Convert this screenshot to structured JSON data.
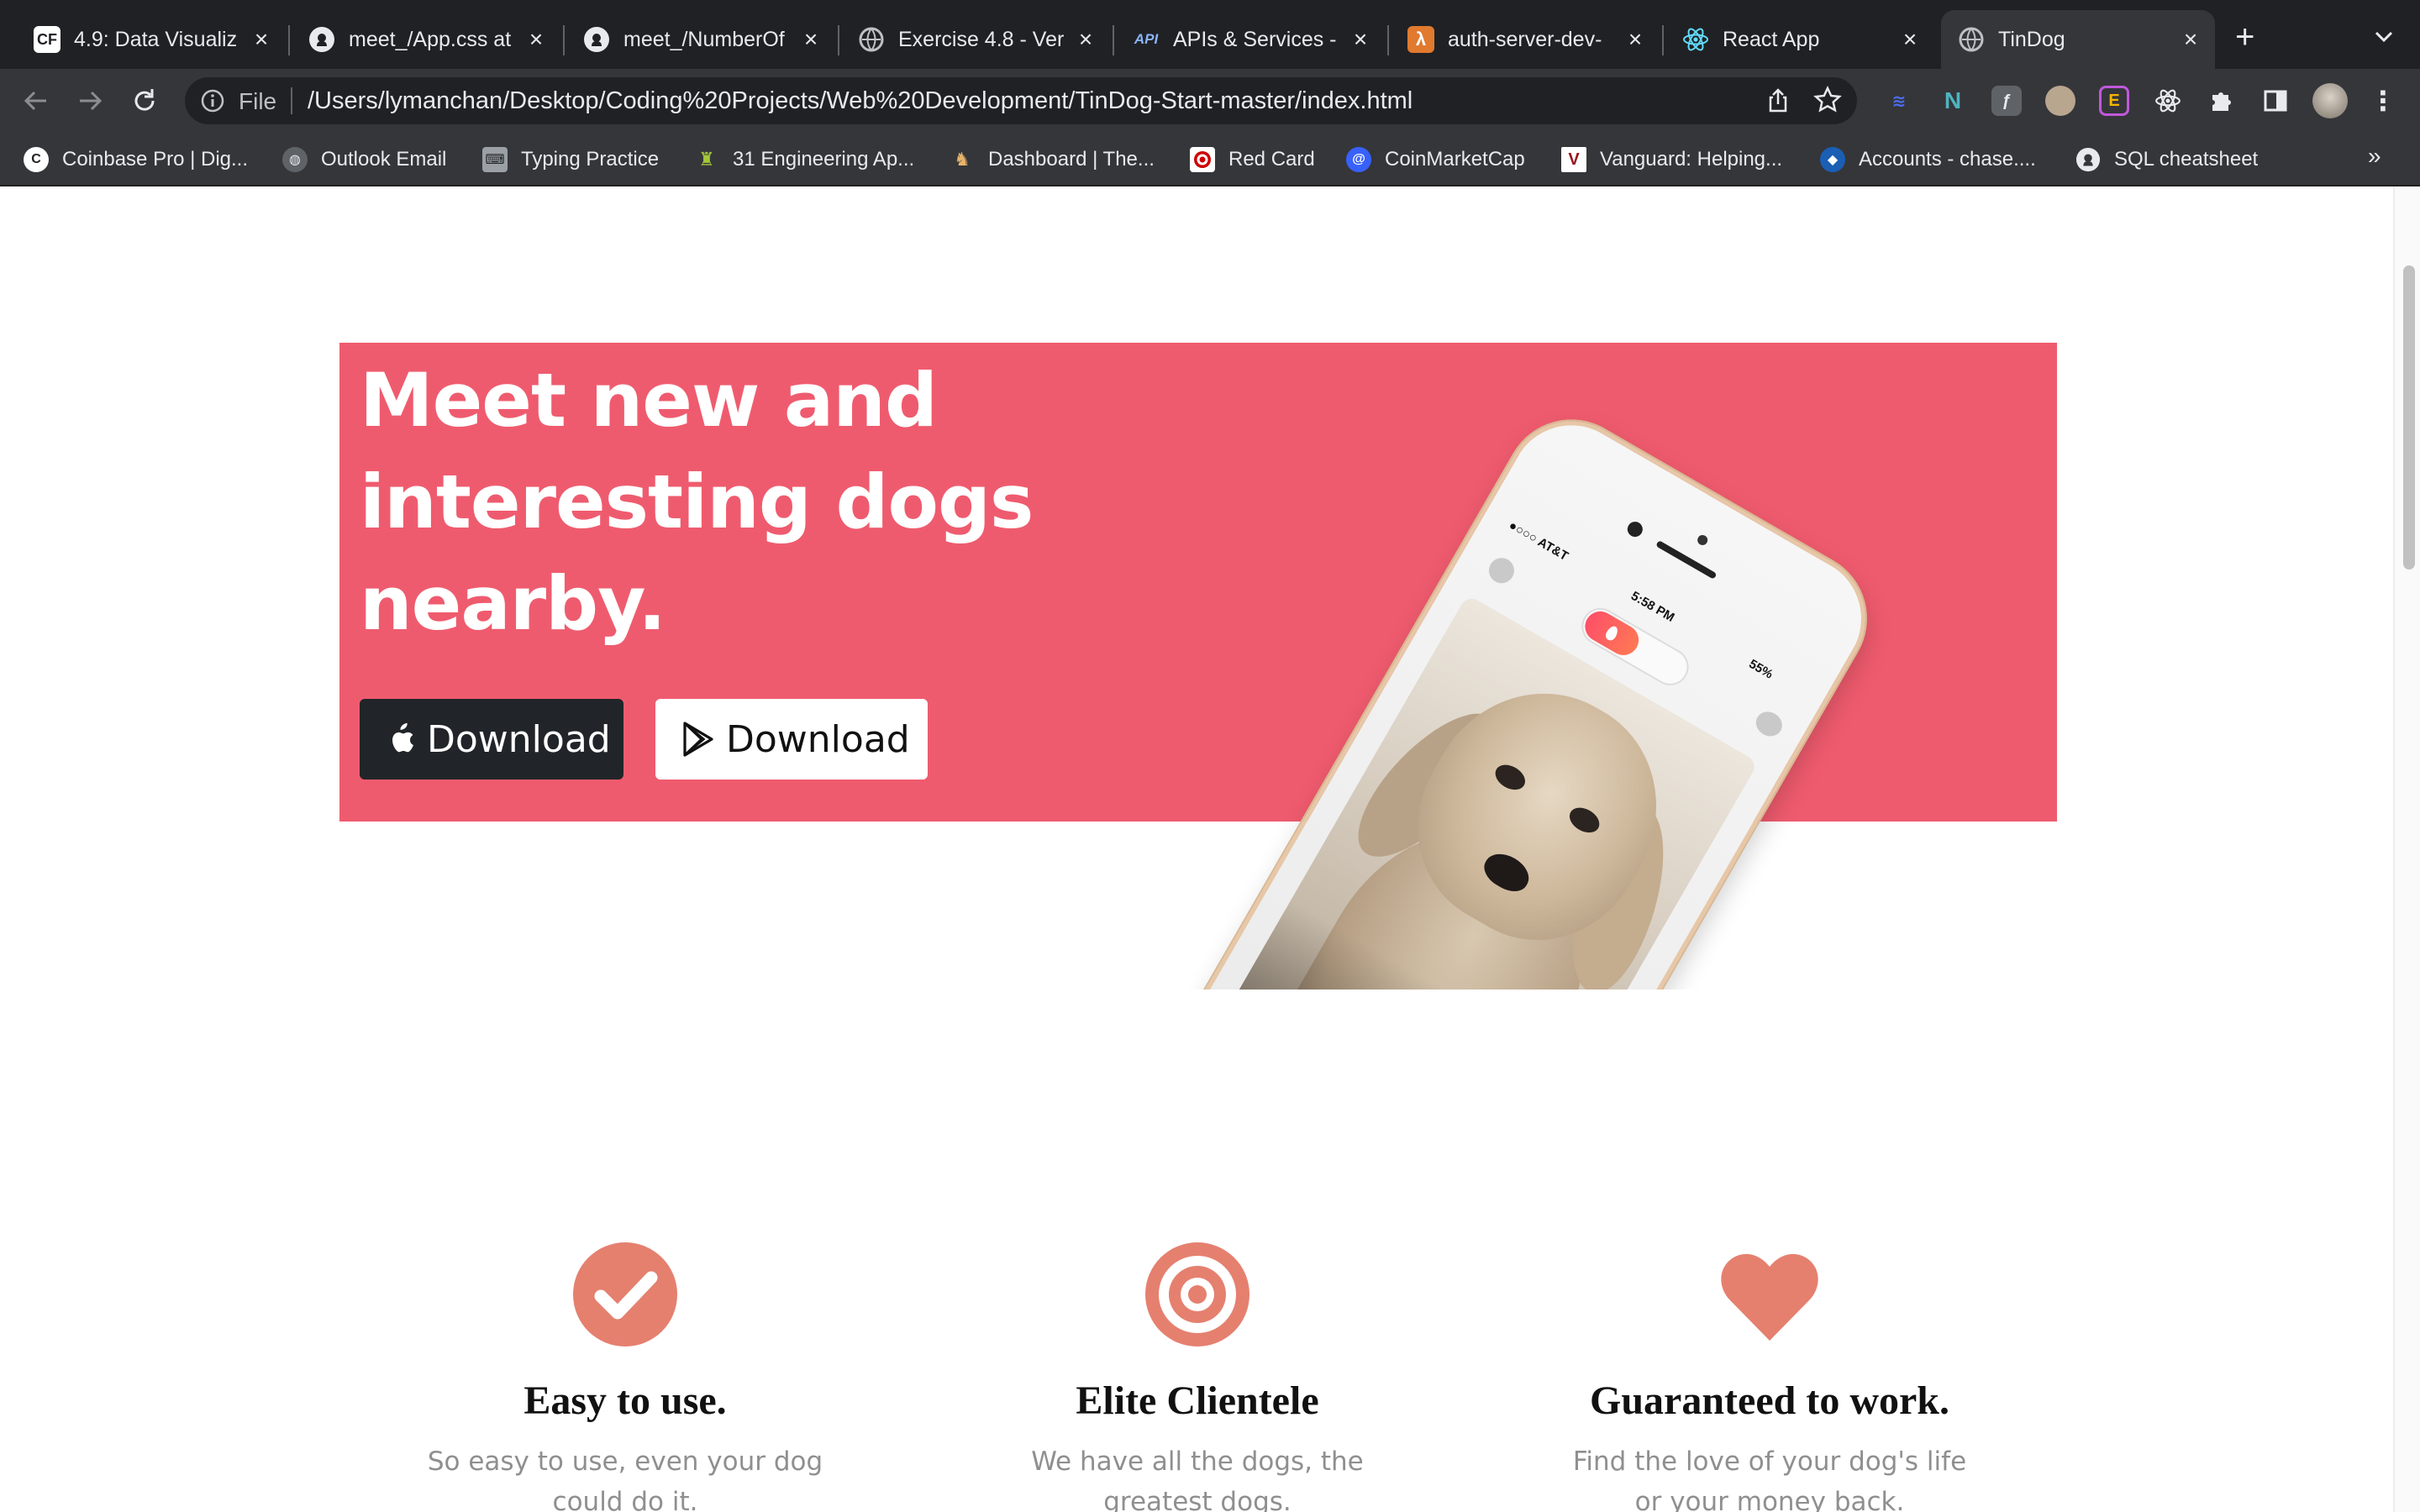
{
  "browser": {
    "tabs": [
      {
        "favicon": "cf-logo-icon",
        "title": "4.9: Data Visualiz",
        "active": false
      },
      {
        "favicon": "github-icon",
        "title": "meet_/App.css at",
        "active": false
      },
      {
        "favicon": "github-icon",
        "title": "meet_/NumberOf",
        "active": false
      },
      {
        "favicon": "globe-icon",
        "title": "Exercise 4.8 - Ver",
        "active": false
      },
      {
        "favicon": "api-icon",
        "title": "APIs & Services -",
        "active": false
      },
      {
        "favicon": "aws-lambda-icon",
        "title": "auth-server-dev-",
        "active": false
      },
      {
        "favicon": "react-icon",
        "title": "React App",
        "active": false
      },
      {
        "favicon": "globe-icon",
        "title": "TinDog",
        "active": true
      }
    ],
    "omnibox": {
      "scheme_label": "File",
      "url": "/Users/lymanchan/Desktop/Coding%20Projects/Web%20Development/TinDog-Start-master/index.html"
    },
    "bookmarks": [
      {
        "icon": "coinbase-icon",
        "label": "Coinbase Pro | Dig..."
      },
      {
        "icon": "globe-icon",
        "label": "Outlook Email"
      },
      {
        "icon": "typing-icon",
        "label": "Typing Practice"
      },
      {
        "icon": "android-icon",
        "label": "31 Engineering Ap..."
      },
      {
        "icon": "fox-icon",
        "label": "Dashboard | The..."
      },
      {
        "icon": "target-icon",
        "label": "Red Card"
      },
      {
        "icon": "coinmarketcap-icon",
        "label": "CoinMarketCap"
      },
      {
        "icon": "vanguard-icon",
        "label": "Vanguard: Helping..."
      },
      {
        "icon": "chase-icon",
        "label": "Accounts - chase...."
      },
      {
        "icon": "github-icon",
        "label": "SQL cheatsheet"
      }
    ],
    "bookmarks_overflow": "»"
  },
  "page": {
    "hero": {
      "title": "Meet new and interesting dogs nearby.",
      "download_apple": "Download",
      "download_play": "Download",
      "background_color": "#ef5b6e"
    },
    "phone": {
      "carrier": "●○○○ AT&T",
      "time": "5:58 PM",
      "battery": "55%"
    },
    "features": [
      {
        "icon": "check-circle-icon",
        "title": "Easy to use.",
        "text": "So easy to use, even your dog could do it."
      },
      {
        "icon": "bullseye-icon",
        "title": "Elite Clientele",
        "text": "We have all the dogs, the greatest dogs."
      },
      {
        "icon": "heart-icon",
        "title": "Guaranteed to work.",
        "text": "Find the love of your dog's life or your money back."
      }
    ],
    "icon_color": "#e5806f"
  }
}
